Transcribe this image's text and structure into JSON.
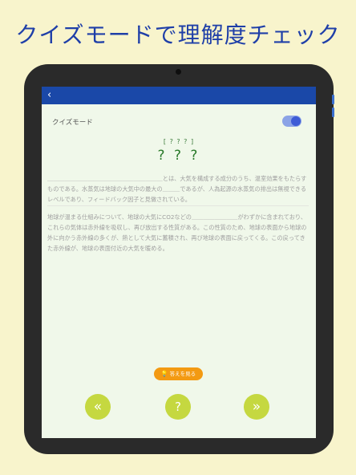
{
  "headline": "クイズモードで理解度チェック",
  "app": {
    "back_icon": "chevron-left-icon",
    "quiz_mode_label": "クイズモード",
    "quiz_mode_enabled": true,
    "question_bracket": "[ ? ? ? ]",
    "question_title": "? ? ?",
    "paragraph_1": "＿＿＿＿＿＿＿＿＿＿＿＿＿＿＿＿＿＿＿＿とは、大気を構成する成分のうち、温室効果をもたらすものである。水蒸気は地球の大気中の最大の＿＿＿であるが、人為起源の水蒸気の排出は無視できるレベルであり、フィードバック因子と見做されている。",
    "paragraph_2": "地球が温まる仕組みについて、地球の大気にCO2などの＿＿＿＿＿＿＿＿がわずかに含まれており、これらの気体は赤外線を吸収し、再び放出する性質がある。この性質のため、地球の表面から地球の外に向かう赤外線の多くが、熱として大気に蓄積され、再び地球の表面に戻ってくる。この戻ってきた赤外線が、地球の表面付近の大気を暖める。",
    "show_answer_label": "答えを見る",
    "show_answer_icon": "lightbulb-icon",
    "prev_label": "«",
    "hint_label": "?",
    "next_label": "»"
  },
  "colors": {
    "background": "#f8f4cc",
    "headline": "#1f3fa8",
    "topbar": "#1a48a8",
    "answer_button": "#f39a12",
    "nav_button": "#c5d840"
  }
}
